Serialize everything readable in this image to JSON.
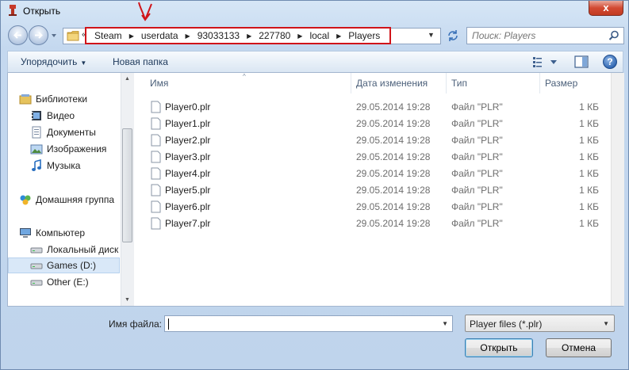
{
  "window": {
    "title": "Открыть",
    "close_glyph": "x"
  },
  "address": {
    "overflow_glyph": "«",
    "crumbs": [
      "Steam",
      "userdata",
      "93033133",
      "227780",
      "local",
      "Players"
    ]
  },
  "search": {
    "placeholder": "Поиск: Players"
  },
  "commandbar": {
    "organize": "Упорядочить",
    "new_folder": "Новая папка",
    "help_glyph": "?"
  },
  "navpane": {
    "libraries": "Библиотеки",
    "videos": "Видео",
    "documents": "Документы",
    "pictures": "Изображения",
    "music": "Музыка",
    "homegroup": "Домашняя группа",
    "computer": "Компьютер",
    "local_disk": "Локальный диск",
    "games_drive": "Games (D:)",
    "other_drive": "Other (E:)"
  },
  "columns": {
    "name": "Имя",
    "date": "Дата изменения",
    "type": "Тип",
    "size": "Размер"
  },
  "files": [
    {
      "name": "Player0.plr",
      "date": "29.05.2014 19:28",
      "type": "Файл \"PLR\"",
      "size": "1 КБ"
    },
    {
      "name": "Player1.plr",
      "date": "29.05.2014 19:28",
      "type": "Файл \"PLR\"",
      "size": "1 КБ"
    },
    {
      "name": "Player2.plr",
      "date": "29.05.2014 19:28",
      "type": "Файл \"PLR\"",
      "size": "1 КБ"
    },
    {
      "name": "Player3.plr",
      "date": "29.05.2014 19:28",
      "type": "Файл \"PLR\"",
      "size": "1 КБ"
    },
    {
      "name": "Player4.plr",
      "date": "29.05.2014 19:28",
      "type": "Файл \"PLR\"",
      "size": "1 КБ"
    },
    {
      "name": "Player5.plr",
      "date": "29.05.2014 19:28",
      "type": "Файл \"PLR\"",
      "size": "1 КБ"
    },
    {
      "name": "Player6.plr",
      "date": "29.05.2014 19:28",
      "type": "Файл \"PLR\"",
      "size": "1 КБ"
    },
    {
      "name": "Player7.plr",
      "date": "29.05.2014 19:28",
      "type": "Файл \"PLR\"",
      "size": "1 КБ"
    }
  ],
  "bottom": {
    "filename_label": "Имя файла:",
    "filename_value": "",
    "filter_value": "Player files (*.plr)",
    "open_button": "Открыть",
    "cancel_button": "Отмена"
  },
  "colors": {
    "annotation_red": "#d0141a",
    "selection_bg": "#d9e8f8"
  }
}
